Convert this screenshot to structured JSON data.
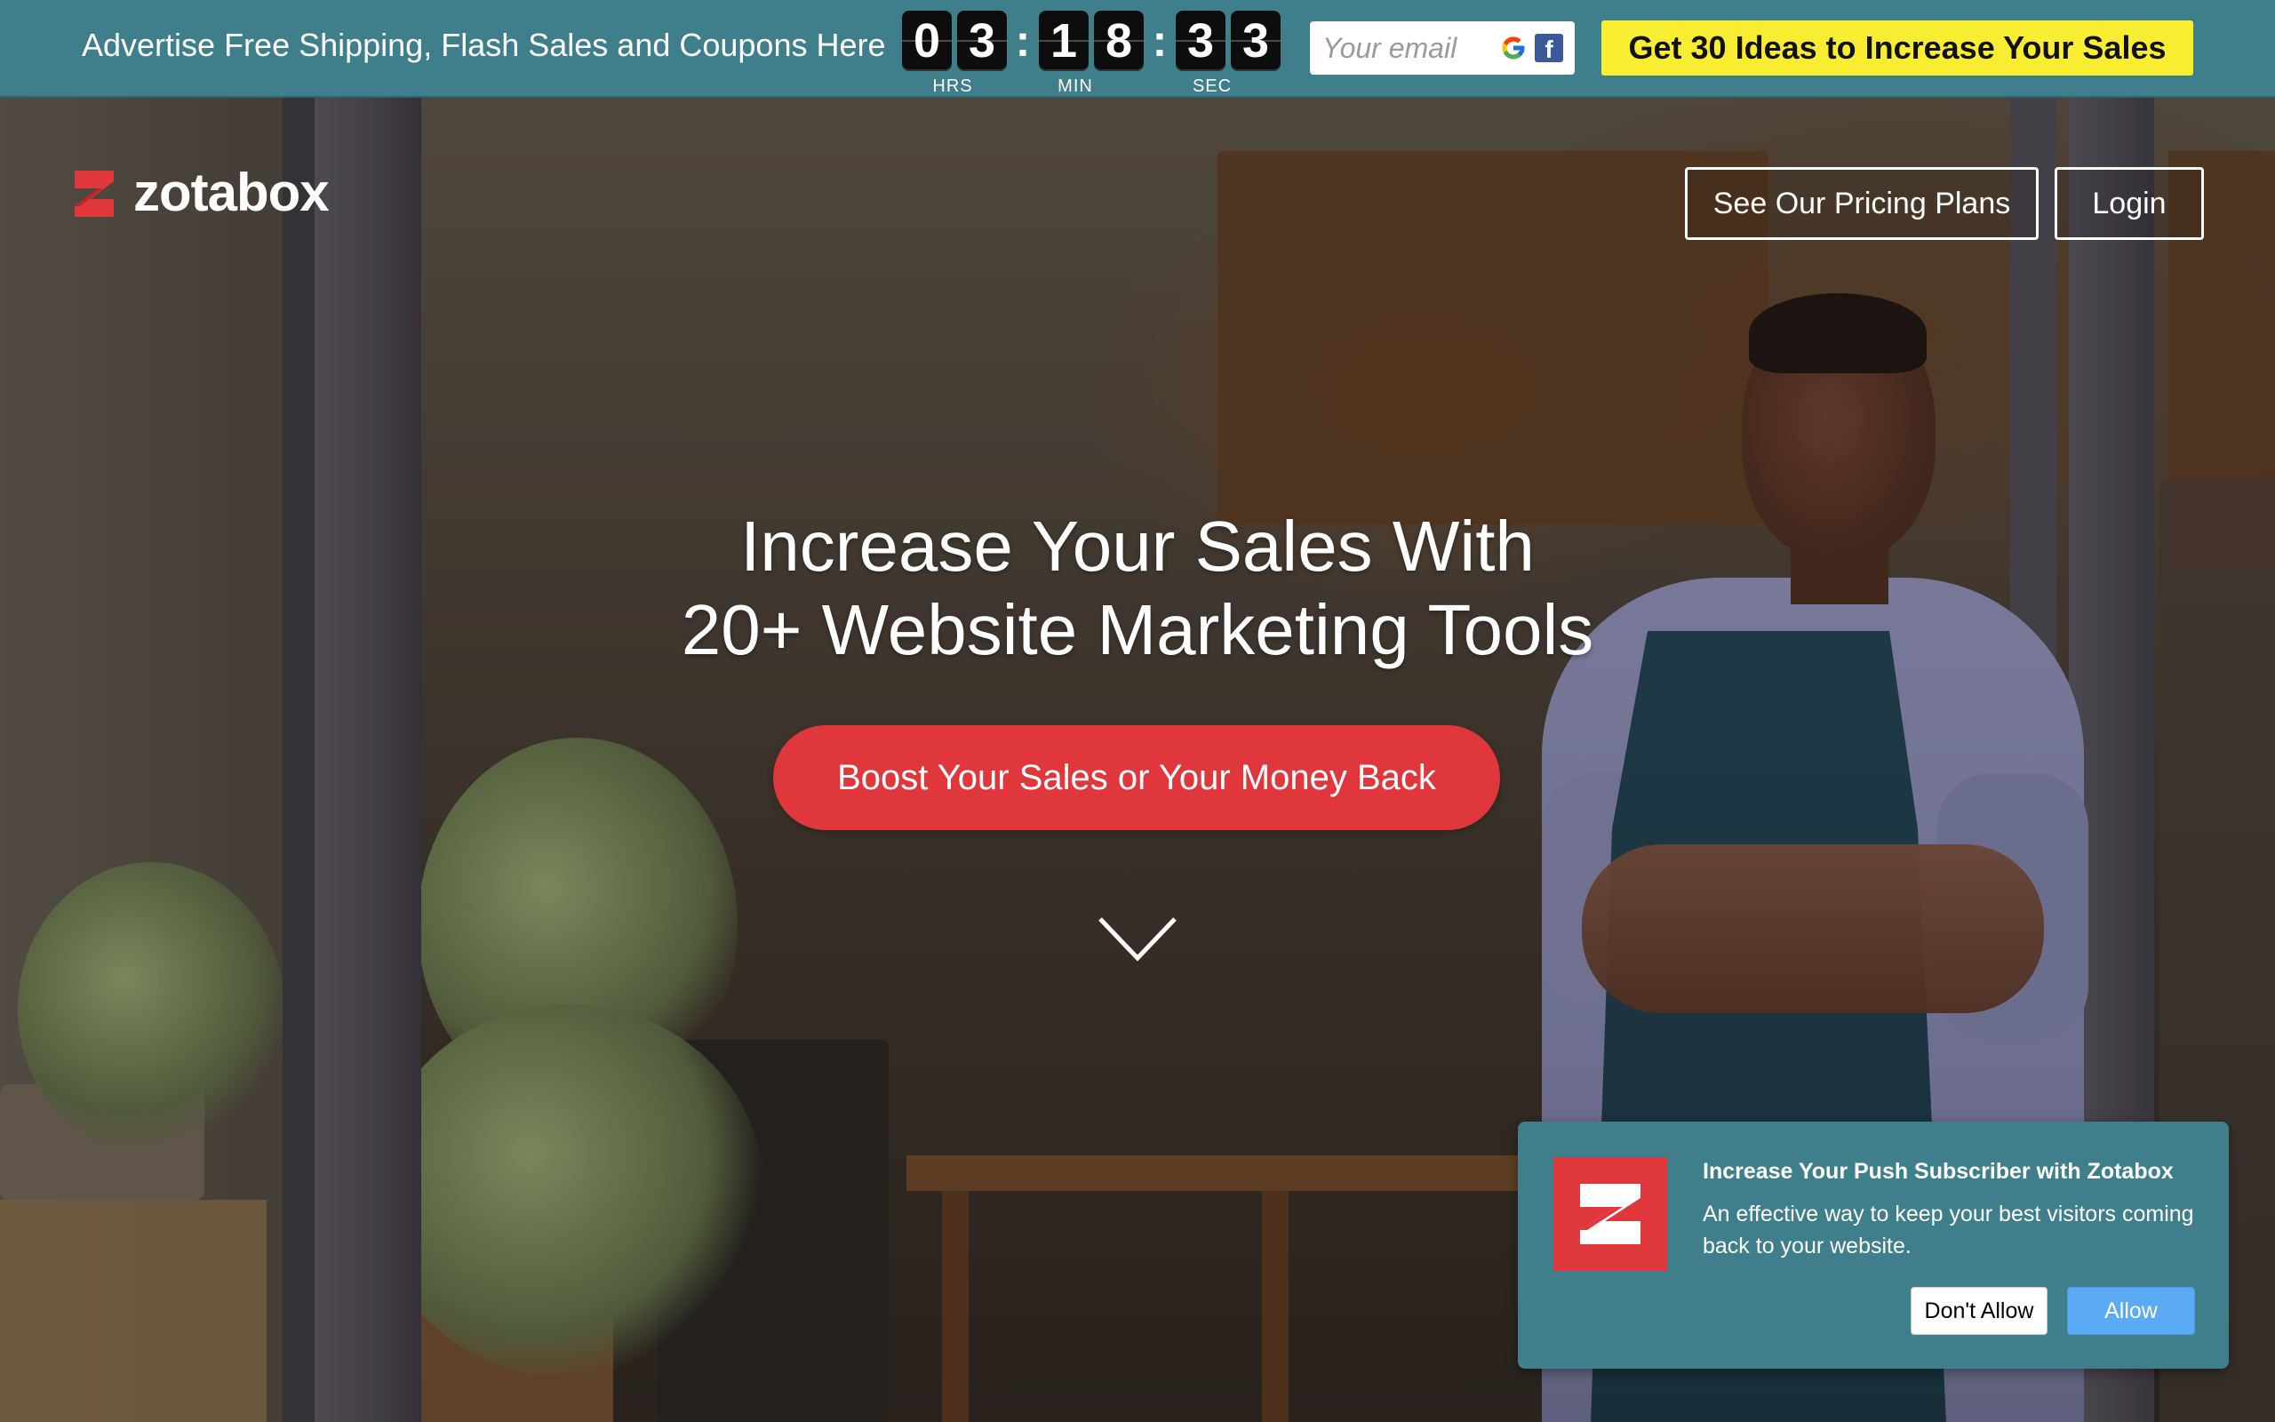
{
  "topbar": {
    "promo_text": "Advertise Free Shipping, Flash Sales and Coupons Here",
    "countdown": {
      "hours": [
        "0",
        "3"
      ],
      "minutes": [
        "1",
        "8"
      ],
      "seconds": [
        "3",
        "3"
      ],
      "separator": ":",
      "labels": {
        "hours": "HRS",
        "minutes": "MIN",
        "seconds": "SEC"
      }
    },
    "email_placeholder": "Your email",
    "social_icons": [
      "google-icon",
      "facebook-icon"
    ],
    "facebook_glyph": "f",
    "cta_label": "Get 30 Ideas to Increase Your Sales",
    "colors": {
      "bar": "#3f7f8c",
      "cta": "#f9ed32"
    }
  },
  "nav": {
    "logo_text": "zotabox",
    "pricing_label": "See Our Pricing Plans",
    "login_label": "Login"
  },
  "hero": {
    "title_line1": "Increase Your Sales With",
    "title_line2": "20+ Website Marketing Tools",
    "cta_label": "Boost Your Sales or Your Money Back",
    "scroll_icon": "chevron-down-icon",
    "colors": {
      "cta": "#e0373c"
    }
  },
  "push_prompt": {
    "title": "Increase Your Push Subscriber with Zotabox",
    "description": "An effective way to keep your best visitors coming back to your website.",
    "deny_label": "Don't Allow",
    "allow_label": "Allow",
    "colors": {
      "background": "#3f7f8c",
      "allow": "#5aabf3"
    }
  }
}
